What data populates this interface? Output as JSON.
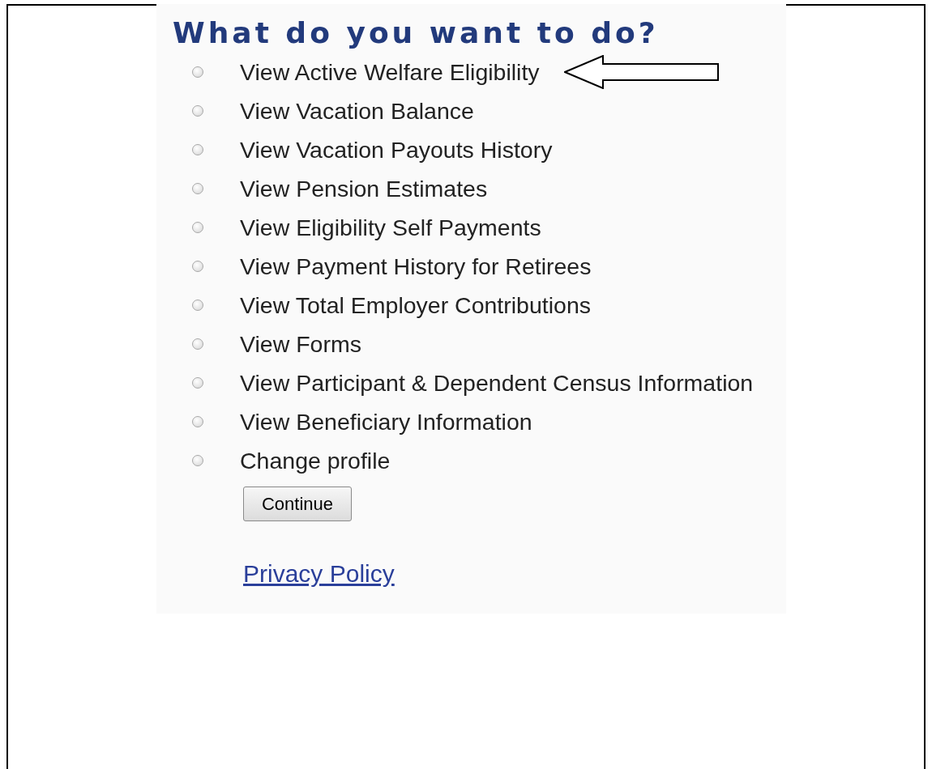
{
  "heading": "What do you want to do?",
  "options": [
    {
      "label": "View Active Welfare Eligibility",
      "selected": false,
      "pointed": true
    },
    {
      "label": "View Vacation Balance",
      "selected": false,
      "pointed": false
    },
    {
      "label": "View Vacation Payouts History",
      "selected": false,
      "pointed": false
    },
    {
      "label": "View Pension Estimates",
      "selected": false,
      "pointed": false
    },
    {
      "label": "View Eligibility Self Payments",
      "selected": false,
      "pointed": false
    },
    {
      "label": "View Payment History for Retirees",
      "selected": false,
      "pointed": false
    },
    {
      "label": "View Total Employer Contributions",
      "selected": false,
      "pointed": false
    },
    {
      "label": "View Forms",
      "selected": false,
      "pointed": false
    },
    {
      "label": "View Participant & Dependent Census Information",
      "selected": false,
      "pointed": false
    },
    {
      "label": "View Beneficiary Information",
      "selected": false,
      "pointed": false
    },
    {
      "label": "Change profile",
      "selected": false,
      "pointed": false
    }
  ],
  "button": "Continue",
  "link": "Privacy Policy"
}
